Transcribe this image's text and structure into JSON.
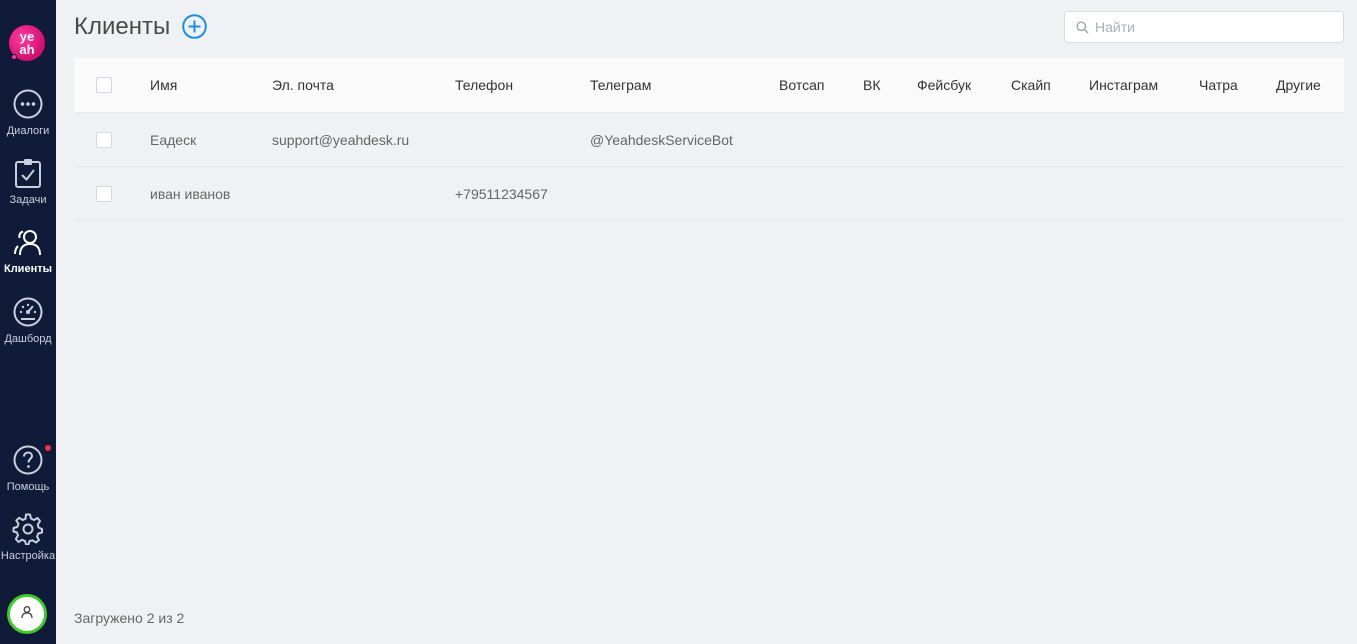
{
  "sidebar": {
    "logo_text": "ye ah",
    "items": [
      {
        "label": "Диалоги",
        "icon": "chat-icon",
        "active": false
      },
      {
        "label": "Задачи",
        "icon": "tasks-icon",
        "active": false
      },
      {
        "label": "Клиенты",
        "icon": "clients-icon",
        "active": true
      },
      {
        "label": "Дашборд",
        "icon": "dashboard-icon",
        "active": false
      },
      {
        "label": "Помощь",
        "icon": "help-icon",
        "active": false
      },
      {
        "label": "Настройка",
        "icon": "gear-icon",
        "active": false
      }
    ],
    "colors": {
      "background": "#0f1b38",
      "logo": "#d10f6e",
      "notification": "#ff2d3b",
      "avatar_ring": "#3fca2a"
    }
  },
  "header": {
    "title": "Клиенты",
    "add_icon": "plus-circle-icon",
    "accent": "#1a8fe3"
  },
  "search": {
    "placeholder": "Найти",
    "value": ""
  },
  "table": {
    "columns": [
      "Имя",
      "Эл. почта",
      "Телефон",
      "Телеграм",
      "Вотсап",
      "ВК",
      "Фейсбук",
      "Скайп",
      "Инстаграм",
      "Чатра",
      "Другие"
    ],
    "rows": [
      {
        "name": "Еадеск",
        "email": "support@yeahdesk.ru",
        "phone": "",
        "telegram": "@YeahdeskServiceBot"
      },
      {
        "name": "иван иванов",
        "email": "",
        "phone": "+79511234567",
        "telegram": ""
      }
    ]
  },
  "footer": {
    "loaded_text": "Загружено 2 из 2"
  }
}
